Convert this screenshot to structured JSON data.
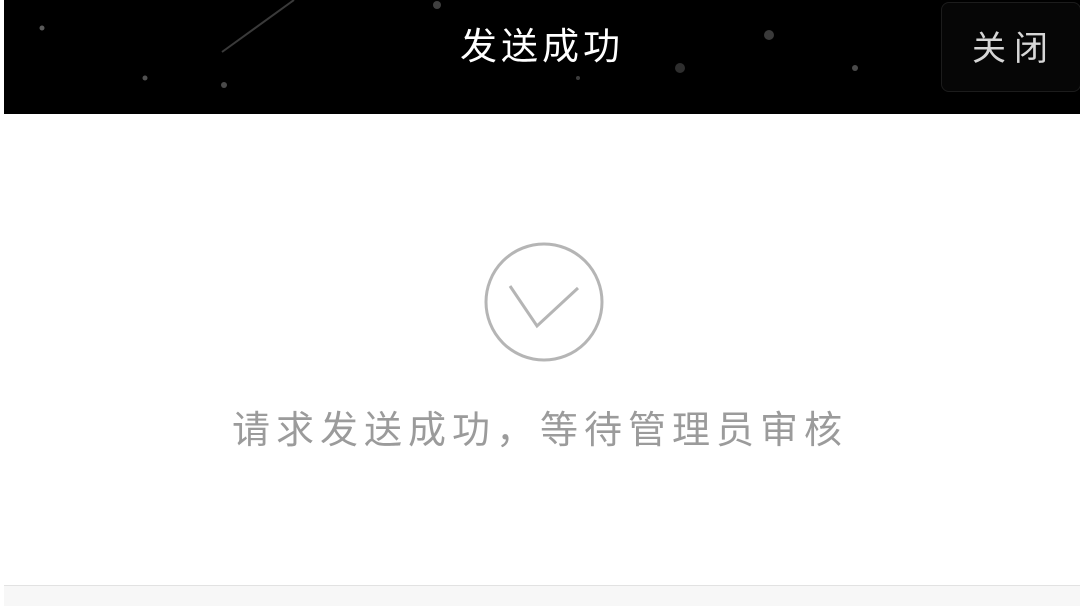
{
  "header": {
    "title": "发送成功",
    "close_label": "关闭"
  },
  "main": {
    "status_icon": "check-circle-icon",
    "message": "请求发送成功，等待管理员审核"
  },
  "colors": {
    "header_background": "#000000",
    "icon_stroke": "#b5b5b5",
    "message_text": "#9b9b9b"
  }
}
